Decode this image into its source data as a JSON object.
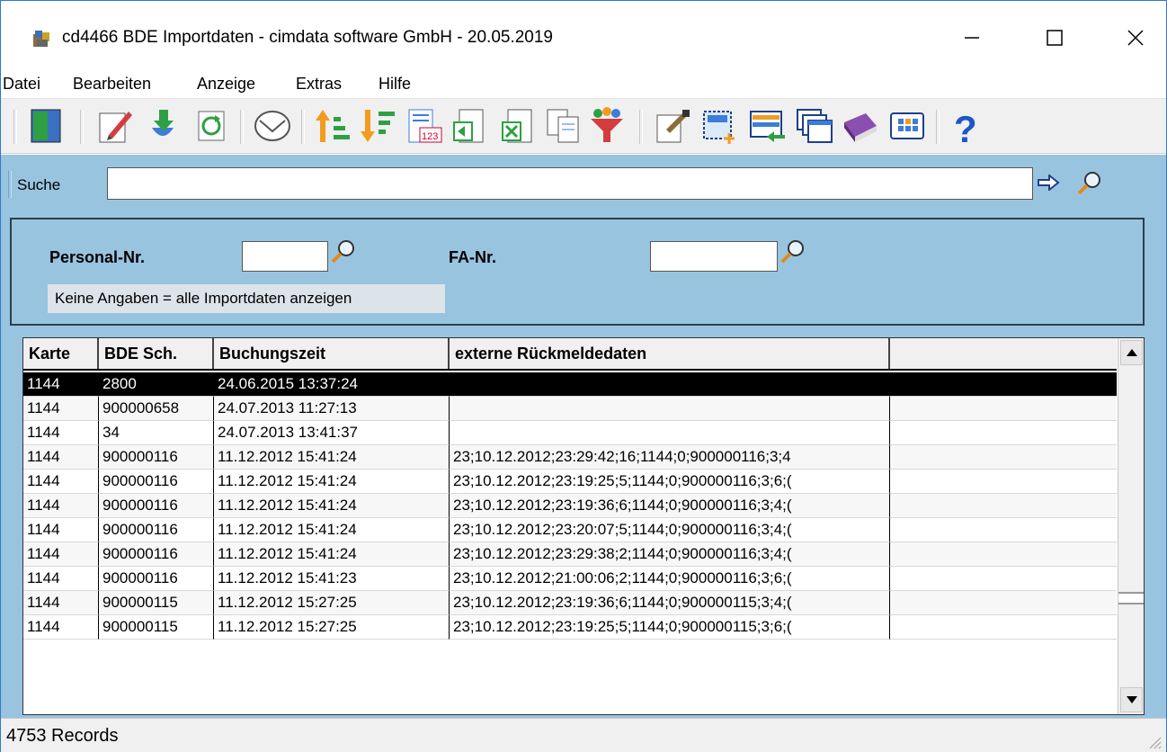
{
  "window": {
    "title": "cd4466 BDE Importdaten - cimdata software GmbH - 20.05.2019"
  },
  "menu": [
    "Datei",
    "Bearbeiten",
    "Anzeige",
    "Extras",
    "Hilfe"
  ],
  "toolbar": {
    "icons": [
      "exit-door-icon",
      "edit-pencil-icon",
      "import-download-icon",
      "refresh-icon",
      "email-envelope-icon",
      "sort-ascending-icon",
      "sort-descending-icon",
      "number-format-icon",
      "export-print-icon",
      "export-excel-icon",
      "copy-pages-icon",
      "filter-funnel-icon",
      "edit-record-icon",
      "new-selection-icon",
      "transfer-icon",
      "windows-cascade-icon",
      "book-manual-icon",
      "calendar-grid-icon",
      "help-question-icon"
    ]
  },
  "search": {
    "label": "Suche",
    "value": "",
    "go_icon": "arrow-right-icon",
    "search_icon": "magnifier-icon"
  },
  "filters": {
    "personal_label": "Personal-Nr.",
    "personal_value": "",
    "fa_label": "FA-Nr.",
    "fa_value": "",
    "hint": "Keine Angaben = alle Importdaten anzeigen"
  },
  "table": {
    "columns": [
      "Karte",
      "BDE Sch.",
      "Buchungszeit",
      "externe Rückmeldedaten",
      ""
    ],
    "rows": [
      [
        "1144",
        "2800",
        "24.06.2015 13:37:24",
        ""
      ],
      [
        "1144",
        "900000658",
        "24.07.2013 11:27:13",
        ""
      ],
      [
        "1144",
        "34",
        "24.07.2013 13:41:37",
        ""
      ],
      [
        "1144",
        "900000116",
        "11.12.2012 15:41:24",
        "23;10.12.2012;23:29:42;16;1144;0;900000116;3;4"
      ],
      [
        "1144",
        "900000116",
        "11.12.2012 15:41:24",
        "23;10.12.2012;23:19:25;5;1144;0;900000116;3;6;("
      ],
      [
        "1144",
        "900000116",
        "11.12.2012 15:41:24",
        "23;10.12.2012;23:19:36;6;1144;0;900000116;3;4;("
      ],
      [
        "1144",
        "900000116",
        "11.12.2012 15:41:24",
        "23;10.12.2012;23:20:07;5;1144;0;900000116;3;4;("
      ],
      [
        "1144",
        "900000116",
        "11.12.2012 15:41:24",
        "23;10.12.2012;23:29:38;2;1144;0;900000116;3;4;("
      ],
      [
        "1144",
        "900000116",
        "11.12.2012 15:41:23",
        "23;10.12.2012;21:00:06;2;1144;0;900000116;3;6;("
      ],
      [
        "1144",
        "900000115",
        "11.12.2012 15:27:25",
        "23;10.12.2012;23:19:36;6;1144;0;900000115;3;4;("
      ],
      [
        "1144",
        "900000115",
        "11.12.2012 15:27:25",
        "23;10.12.2012;23:19:25;5;1144;0;900000115;3;6;("
      ]
    ],
    "selected_row": 0
  },
  "status": {
    "records": "4753 Records"
  },
  "colors": {
    "content_bg": "#99c4df",
    "window_border": "#2b79d1",
    "selection": "#000000"
  }
}
